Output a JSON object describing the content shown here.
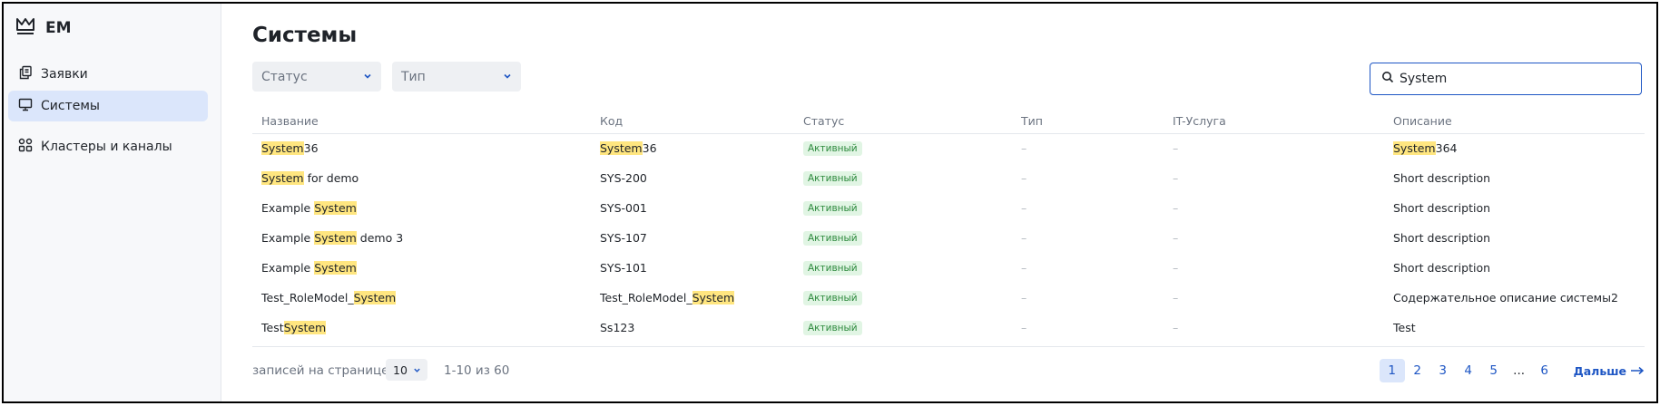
{
  "app": {
    "brand": "EM",
    "brand_icon": "crown-icon"
  },
  "sidebar": {
    "items": [
      {
        "label": "Заявки",
        "icon": "copy-icon",
        "active": false
      },
      {
        "label": "Системы",
        "icon": "monitor-icon",
        "active": true
      },
      {
        "label": "Кластеры и каналы",
        "icon": "grid-icon",
        "active": false
      }
    ]
  },
  "page": {
    "title": "Системы"
  },
  "filters": {
    "status_placeholder": "Статус",
    "type_placeholder": "Тип"
  },
  "search": {
    "value": "System",
    "icon": "search-icon"
  },
  "table": {
    "headers": [
      "Название",
      "Код",
      "Статус",
      "Тип",
      "IT-Услуга",
      "Описание"
    ],
    "rows": [
      {
        "name": [
          "",
          "System",
          "36"
        ],
        "code": [
          "",
          "System",
          "36"
        ],
        "status": "Активный",
        "type": "–",
        "service": "–",
        "desc": [
          "",
          "System",
          "364"
        ]
      },
      {
        "name": [
          "",
          "System",
          " for demo"
        ],
        "code": [
          "SYS-200",
          "",
          ""
        ],
        "status": "Активный",
        "type": "–",
        "service": "–",
        "desc": [
          "Short description",
          "",
          ""
        ]
      },
      {
        "name": [
          "Example ",
          "System",
          ""
        ],
        "code": [
          "SYS-001",
          "",
          ""
        ],
        "status": "Активный",
        "type": "–",
        "service": "–",
        "desc": [
          "Short description",
          "",
          ""
        ]
      },
      {
        "name": [
          "Example ",
          "System",
          " demo 3"
        ],
        "code": [
          "SYS-107",
          "",
          ""
        ],
        "status": "Активный",
        "type": "–",
        "service": "–",
        "desc": [
          "Short description",
          "",
          ""
        ]
      },
      {
        "name": [
          "Example ",
          "System",
          ""
        ],
        "code": [
          "SYS-101",
          "",
          ""
        ],
        "status": "Активный",
        "type": "–",
        "service": "–",
        "desc": [
          "Short description",
          "",
          ""
        ]
      },
      {
        "name": [
          "Test_RoleModel_",
          "System",
          ""
        ],
        "code": [
          "Test_RoleModel_",
          "System",
          ""
        ],
        "status": "Активный",
        "type": "–",
        "service": "–",
        "desc": [
          "Содержательное описание системы2",
          "",
          ""
        ]
      },
      {
        "name": [
          "Test",
          "System",
          ""
        ],
        "code": [
          "Ss123",
          "",
          ""
        ],
        "status": "Активный",
        "type": "–",
        "service": "–",
        "desc": [
          "Test",
          "",
          ""
        ]
      }
    ]
  },
  "colors": {
    "accent": "#1e56c4",
    "highlight": "#ffe680",
    "status_bg": "#e1f5e4",
    "status_text": "#2e8a3e",
    "active_nav": "#dbe6fb"
  },
  "pagination": {
    "per_page_label": "записей на странице",
    "per_page_value": "10",
    "range": "1-10 из 60",
    "pages": [
      "1",
      "2",
      "3",
      "4",
      "5",
      "...",
      "6"
    ],
    "current": "1",
    "next_label": "Дальше"
  }
}
